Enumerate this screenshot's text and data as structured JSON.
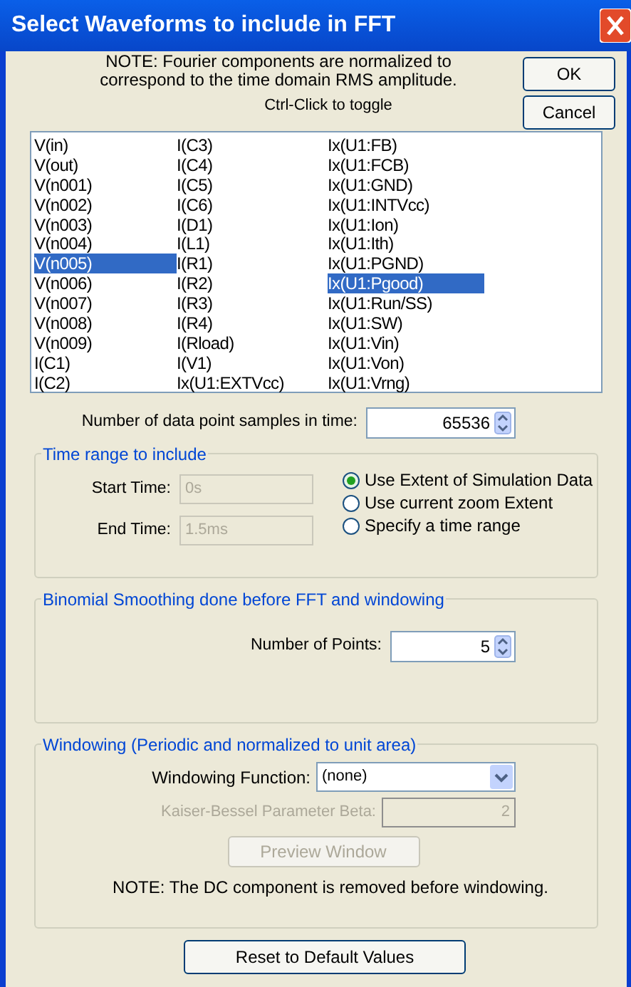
{
  "window": {
    "title": "Select Waveforms to include in FFT"
  },
  "note": "NOTE:  Fourier components are normalized to correspond to the time domain RMS amplitude.",
  "buttons": [
    {
      "label": "OK"
    },
    {
      "label": "Cancel"
    }
  ],
  "hint": "Ctrl-Click to toggle",
  "waveforms": [
    [
      {
        "label": "V(in)",
        "selected": false
      },
      {
        "label": "V(out)",
        "selected": false
      },
      {
        "label": "V(n001)",
        "selected": false
      },
      {
        "label": "V(n002)",
        "selected": false
      },
      {
        "label": "V(n003)",
        "selected": false
      },
      {
        "label": "V(n004)",
        "selected": false
      },
      {
        "label": "V(n005)",
        "selected": true
      },
      {
        "label": "V(n006)",
        "selected": false
      },
      {
        "label": "V(n007)",
        "selected": false
      },
      {
        "label": "V(n008)",
        "selected": false
      },
      {
        "label": "V(n009)",
        "selected": false
      },
      {
        "label": "I(C1)",
        "selected": false
      },
      {
        "label": "I(C2)",
        "selected": false
      }
    ],
    [
      {
        "label": "I(C3)",
        "selected": false
      },
      {
        "label": "I(C4)",
        "selected": false
      },
      {
        "label": "I(C5)",
        "selected": false
      },
      {
        "label": "I(C6)",
        "selected": false
      },
      {
        "label": "I(D1)",
        "selected": false
      },
      {
        "label": "I(L1)",
        "selected": false
      },
      {
        "label": "I(R1)",
        "selected": false
      },
      {
        "label": "I(R2)",
        "selected": false
      },
      {
        "label": "I(R3)",
        "selected": false
      },
      {
        "label": "I(R4)",
        "selected": false
      },
      {
        "label": "I(Rload)",
        "selected": false
      },
      {
        "label": "I(V1)",
        "selected": false
      },
      {
        "label": "Ix(U1:EXTVcc)",
        "selected": false
      }
    ],
    [
      {
        "label": "Ix(U1:FB)",
        "selected": false
      },
      {
        "label": "Ix(U1:FCB)",
        "selected": false
      },
      {
        "label": "Ix(U1:GND)",
        "selected": false
      },
      {
        "label": "Ix(U1:INTVcc)",
        "selected": false
      },
      {
        "label": "Ix(U1:Ion)",
        "selected": false
      },
      {
        "label": "Ix(U1:Ith)",
        "selected": false
      },
      {
        "label": "Ix(U1:PGND)",
        "selected": false
      },
      {
        "label": "Ix(U1:Pgood)",
        "selected": true
      },
      {
        "label": "Ix(U1:Run/SS)",
        "selected": false
      },
      {
        "label": "Ix(U1:SW)",
        "selected": false
      },
      {
        "label": "Ix(U1:Vin)",
        "selected": false
      },
      {
        "label": "Ix(U1:Von)",
        "selected": false
      },
      {
        "label": "Ix(U1:Vrng)",
        "selected": false
      }
    ]
  ],
  "samples": {
    "label": "Number of data point samples in time:",
    "value": "65536"
  },
  "time_range": {
    "title": "Time range to include",
    "fields": [
      {
        "label": "Start Time:",
        "value": "0s",
        "disabled": true
      },
      {
        "label": "End Time:",
        "value": "1.5ms",
        "disabled": true
      }
    ],
    "options": [
      {
        "label": "Use Extent of Simulation Data",
        "selected": true
      },
      {
        "label": "Use current zoom Extent",
        "selected": false
      },
      {
        "label": "Specify a time range",
        "selected": false
      }
    ]
  },
  "smoothing": {
    "title": "Binomial Smoothing done before FFT and windowing",
    "label": "Number of Points:",
    "value": "5"
  },
  "windowing": {
    "title": "Windowing  (Periodic and normalized to unit area)",
    "function_label": "Windowing Function:",
    "function_value": "(none)",
    "beta_label": "Kaiser-Bessel Parameter Beta:",
    "beta_value": "2",
    "beta_disabled": true,
    "preview": {
      "label": "Preview Window",
      "disabled": true
    },
    "note": "NOTE:  The DC component is removed before windowing."
  },
  "reset": {
    "label": "Reset to Default Values"
  }
}
